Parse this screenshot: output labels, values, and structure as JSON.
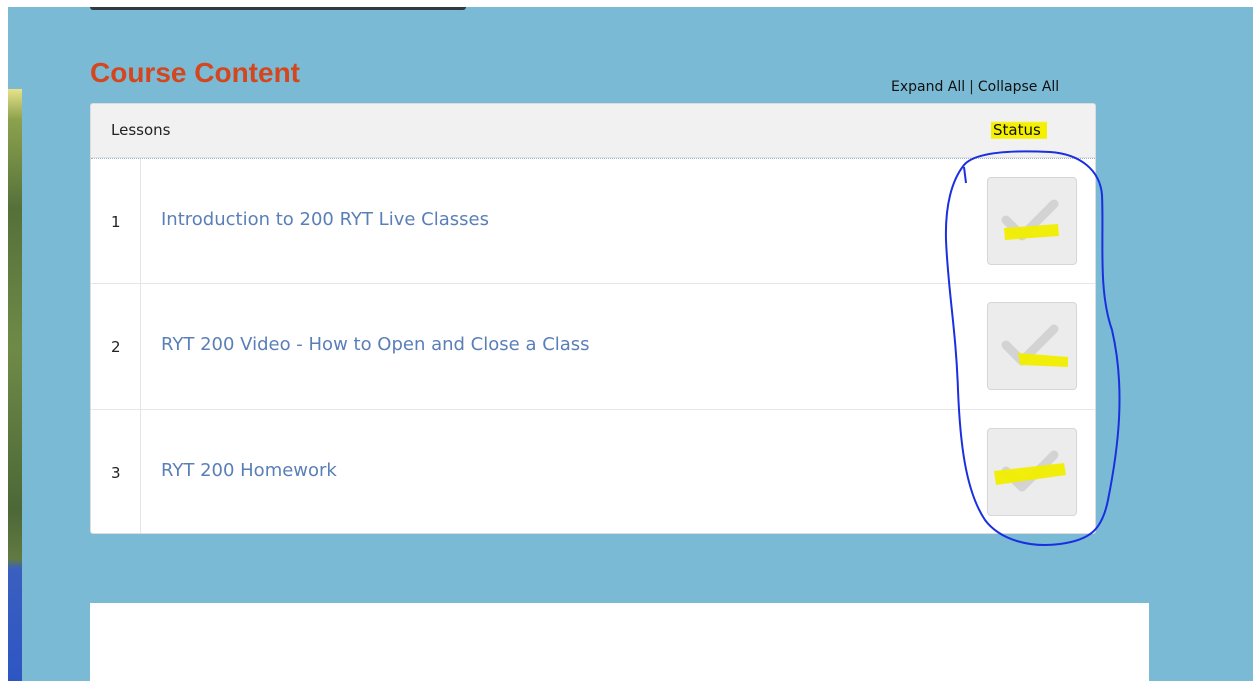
{
  "section": {
    "title": "Course Content"
  },
  "controls": {
    "expand_all": "Expand All",
    "separator": "|",
    "collapse_all": "Collapse All"
  },
  "table": {
    "header": {
      "lessons": "Lessons",
      "status": "Status"
    },
    "rows": [
      {
        "number": "1",
        "title": "Introduction to 200 RYT Live Classes"
      },
      {
        "number": "2",
        "title": "RYT 200 Video - How to Open and Close a Class"
      },
      {
        "number": "3",
        "title": "RYT 200 Homework"
      }
    ]
  },
  "colors": {
    "title": "#d4461d",
    "link": "#5a7fb8",
    "background": "#7bbad4",
    "highlight": "#f4f000",
    "annotation": "#1a2fe0"
  },
  "icons": {
    "status": "checkmark-icon"
  }
}
